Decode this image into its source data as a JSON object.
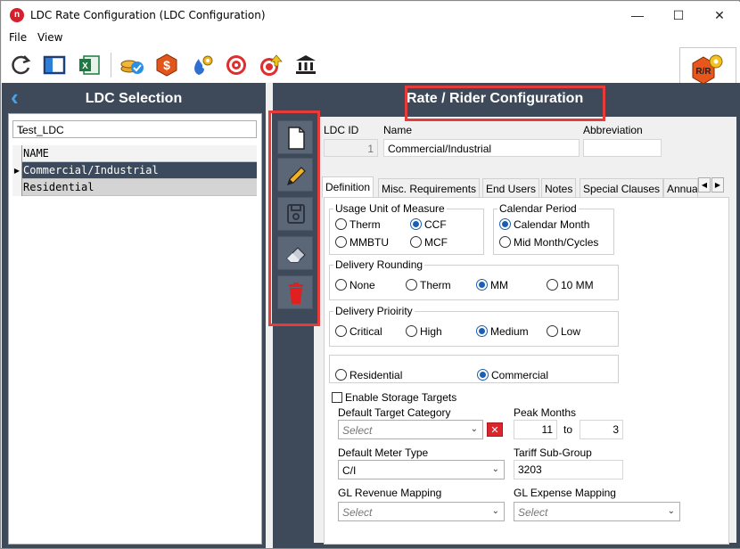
{
  "window": {
    "title": "LDC Rate Configuration (LDC Configuration)",
    "minimize": "—",
    "maximize": "☐",
    "close": "✕"
  },
  "menu": {
    "file": "File",
    "view": "View"
  },
  "left": {
    "title": "LDC Selection",
    "ldc_selected": "Test_LDC",
    "grid_header": "NAME",
    "rows": [
      "Commercial/Industrial",
      "Residential"
    ]
  },
  "right": {
    "title": "Rate / Rider Configuration",
    "ldc_id_label": "LDC ID",
    "ldc_id_value": "1",
    "name_label": "Name",
    "name_value": "Commercial/Industrial",
    "abbrev_label": "Abbreviation",
    "abbrev_value": "",
    "tabs": [
      "Definition",
      "Misc. Requirements",
      "End Users",
      "Notes",
      "Special Clauses",
      "Annua"
    ],
    "usage_group": {
      "title": "Usage Unit of Measure",
      "options": [
        "Therm",
        "CCF",
        "MMBTU",
        "MCF"
      ],
      "selected": "CCF"
    },
    "calendar_group": {
      "title": "Calendar Period",
      "options": [
        "Calendar Month",
        "Mid Month/Cycles"
      ],
      "selected": "Calendar Month"
    },
    "rounding_group": {
      "title": "Delivery Rounding",
      "options": [
        "None",
        "Therm",
        "MM",
        "10 MM"
      ],
      "selected": "MM"
    },
    "priority_group": {
      "title": "Delivery Prioirity",
      "options": [
        "Critical",
        "High",
        "Medium",
        "Low"
      ],
      "selected": "Medium"
    },
    "type_group": {
      "options": [
        "Residential",
        "Commercial"
      ],
      "selected": "Commercial"
    },
    "enable_storage": "Enable Storage Targets",
    "default_target_label": "Default Target Category",
    "default_target_placeholder": "Select",
    "peak_months_label": "Peak Months",
    "peak_from": "11",
    "peak_to_label": "to",
    "peak_to": "3",
    "meter_type_label": "Default Meter Type",
    "meter_type_value": "C/I",
    "tariff_label": "Tariff Sub-Group",
    "tariff_value": "3203",
    "gl_rev_label": "GL Revenue Mapping",
    "gl_rev_placeholder": "Select",
    "gl_exp_label": "GL Expense Mapping",
    "gl_exp_placeholder": "Select"
  },
  "colors": {
    "panel": "#3e4a5a",
    "highlight": "#e53b3b",
    "accent": "#1a5fb4"
  }
}
